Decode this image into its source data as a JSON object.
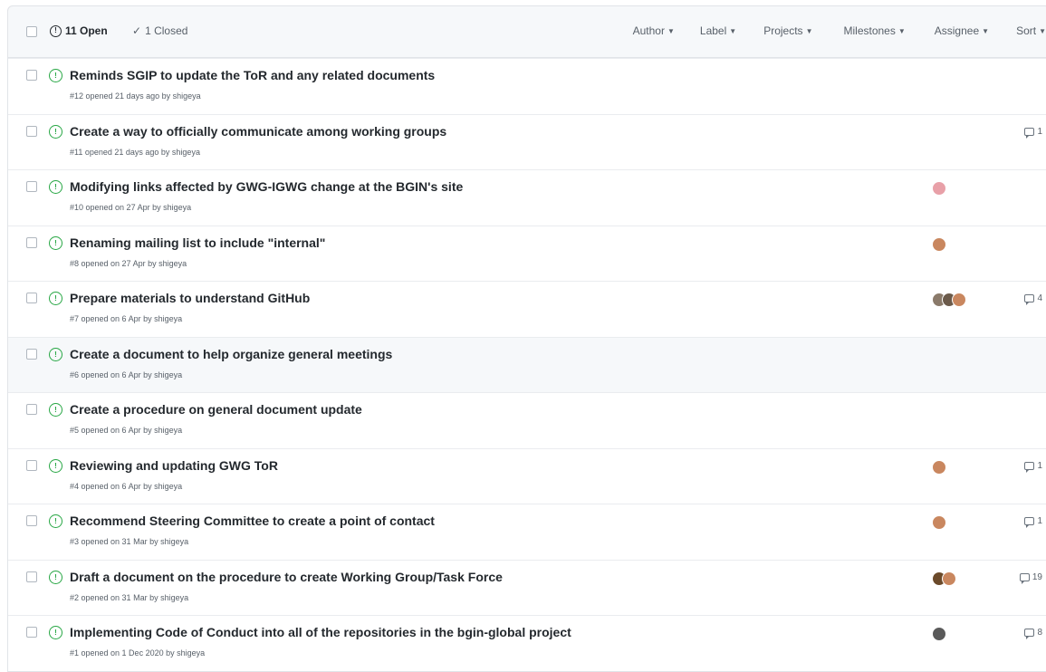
{
  "header": {
    "open_label": "11 Open",
    "closed_label": "1 Closed",
    "filters": [
      "Author",
      "Label",
      "Projects",
      "Milestones",
      "Assignee",
      "Sort"
    ]
  },
  "issues": [
    {
      "title": "Reminds SGIP to update the ToR and any related documents",
      "meta": "#12 opened 21 days ago by shigeya",
      "comments": "",
      "avatars": []
    },
    {
      "title": "Create a way to officially communicate among working groups",
      "meta": "#11 opened 21 days ago by shigeya",
      "comments": "1",
      "avatars": []
    },
    {
      "title": "Modifying links affected by GWG-IGWG change at the BGIN's site",
      "meta": "#10 opened on 27 Apr by shigeya",
      "comments": "",
      "avatars": [
        "#e8a0a8"
      ]
    },
    {
      "title": "Renaming mailing list to include \"internal\"",
      "meta": "#8 opened on 27 Apr by shigeya",
      "comments": "",
      "avatars": [
        "#c9875f"
      ]
    },
    {
      "title": "Prepare materials to understand GitHub",
      "meta": "#7 opened on 6 Apr by shigeya",
      "comments": "4",
      "avatars": [
        "#8a7a6a",
        "#6b5a4a",
        "#c9875f"
      ]
    },
    {
      "title": "Create a document to help organize general meetings",
      "meta": "#6 opened on 6 Apr by shigeya",
      "comments": "",
      "avatars": []
    },
    {
      "title": "Create a procedure on general document update",
      "meta": "#5 opened on 6 Apr by shigeya",
      "comments": "",
      "avatars": []
    },
    {
      "title": "Reviewing and updating GWG ToR",
      "meta": "#4 opened on 6 Apr by shigeya",
      "comments": "1",
      "avatars": [
        "#c9875f"
      ]
    },
    {
      "title": "Recommend Steering Committee to create a point of contact",
      "meta": "#3 opened on 31 Mar by shigeya",
      "comments": "1",
      "avatars": [
        "#c9875f"
      ]
    },
    {
      "title": "Draft a document on the procedure to create Working Group/Task Force",
      "meta": "#2 opened on 31 Mar by shigeya",
      "comments": "19",
      "avatars": [
        "#6b4a2a",
        "#c9875f"
      ]
    },
    {
      "title": "Implementing Code of Conduct into all of the repositories in the bgin-global project",
      "meta": "#1 opened on 1 Dec 2020 by shigeya",
      "comments": "8",
      "avatars": [
        "#5a5a5a"
      ]
    }
  ],
  "highlighted_index": 5,
  "colors": {
    "open_green": "#28a745",
    "header_bg": "#f6f8fa",
    "border": "#e1e4e8",
    "muted": "#586069"
  },
  "icons": {
    "open": "issue-opened-icon",
    "closed": "check-icon",
    "comment": "comment-icon"
  }
}
